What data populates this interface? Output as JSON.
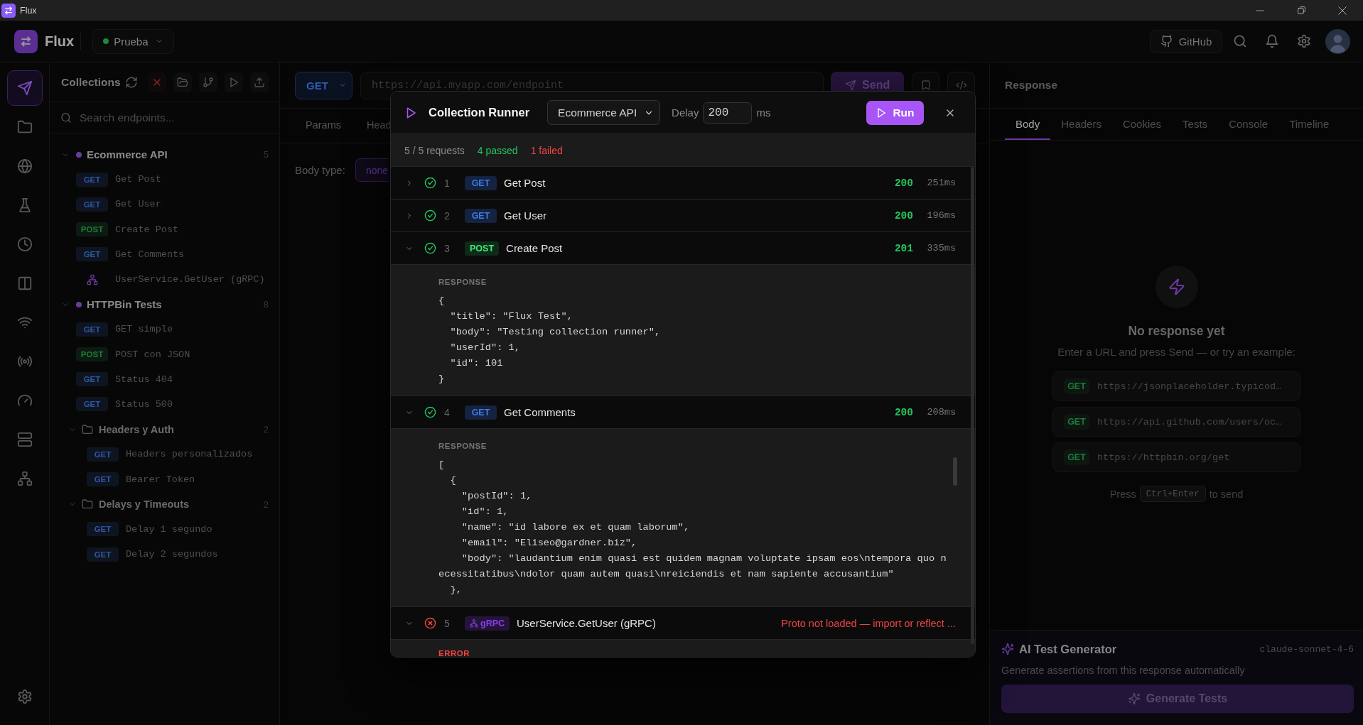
{
  "window": {
    "title": "Flux"
  },
  "header": {
    "app_name": "Flux",
    "environment": "Prueba",
    "github_button": "GitHub"
  },
  "rail": {
    "items": [
      {
        "selected": true
      },
      {
        "selected": false
      },
      {
        "selected": false
      },
      {
        "selected": false
      },
      {
        "selected": false
      },
      {
        "selected": false
      },
      {
        "selected": false
      },
      {
        "selected": false
      },
      {
        "selected": false
      },
      {
        "selected": false
      },
      {
        "selected": false
      }
    ]
  },
  "collections": {
    "title": "Collections",
    "search": {
      "placeholder": "Search endpoints..."
    },
    "tree": [
      {
        "kind": "collection",
        "name": "Ecommerce API",
        "count": "5",
        "expanded": true,
        "children": [
          {
            "kind": "request",
            "method": "GET",
            "color": "#2e56a8",
            "name": "Get Post"
          },
          {
            "kind": "request",
            "method": "GET",
            "color": "#2e56a8",
            "name": "Get User"
          },
          {
            "kind": "request",
            "method": "POST",
            "color": "#1f7f3a",
            "name": "Create Post"
          },
          {
            "kind": "request",
            "method": "GET",
            "color": "#2e56a8",
            "name": "Get Comments"
          },
          {
            "kind": "grpc",
            "name": "UserService.GetUser (gRPC)"
          }
        ]
      },
      {
        "kind": "collection",
        "name": "HTTPBin Tests",
        "count": "8",
        "expanded": true,
        "children": [
          {
            "kind": "request",
            "method": "GET",
            "color": "#2e56a8",
            "name": "GET simple"
          },
          {
            "kind": "request",
            "method": "POST",
            "color": "#1f7f3a",
            "name": "POST con JSON"
          },
          {
            "kind": "request",
            "method": "GET",
            "color": "#2e56a8",
            "name": "Status 404"
          },
          {
            "kind": "request",
            "method": "GET",
            "color": "#2e56a8",
            "name": "Status 500"
          },
          {
            "kind": "folder",
            "name": "Headers y Auth",
            "count": "2",
            "expanded": true,
            "children": [
              {
                "kind": "request",
                "method": "GET",
                "color": "#2e56a8",
                "name": "Headers personalizados"
              },
              {
                "kind": "request",
                "method": "GET",
                "color": "#2e56a8",
                "name": "Bearer Token"
              }
            ]
          },
          {
            "kind": "folder",
            "name": "Delays y Timeouts",
            "count": "2",
            "expanded": true,
            "children": [
              {
                "kind": "request",
                "method": "GET",
                "color": "#2e56a8",
                "name": "Delay 1 segundo"
              },
              {
                "kind": "request",
                "method": "GET",
                "color": "#2e56a8",
                "name": "Delay 2 segundos"
              }
            ]
          }
        ]
      }
    ]
  },
  "request": {
    "method": "GET",
    "url_field": {
      "placeholder": "https://api.myapp.com/endpoint"
    },
    "send_button": "Send",
    "tabs": [
      {
        "label": "Params",
        "selected": false
      },
      {
        "label": "Head",
        "selected": false
      }
    ],
    "body_type_label": "Body type:",
    "body_type": "none"
  },
  "response_panel": {
    "title": "Response",
    "tabs": [
      {
        "label": "Body",
        "selected": true
      },
      {
        "label": "Headers",
        "selected": false
      },
      {
        "label": "Cookies",
        "selected": false
      },
      {
        "label": "Tests",
        "selected": false
      },
      {
        "label": "Console",
        "selected": false
      },
      {
        "label": "Timeline",
        "selected": false
      }
    ],
    "empty_state": {
      "title": "No response yet",
      "subtitle": "Enter a URL and press Send — or try an example:",
      "examples": [
        {
          "method": "GET",
          "color": "#1e7a3c",
          "url": "https://jsonplaceholder.typicod…"
        },
        {
          "method": "GET",
          "color": "#1e7a3c",
          "url": "https://api.github.com/users/oc…"
        },
        {
          "method": "GET",
          "color": "#1e7a3c",
          "url": "https://httpbin.org/get"
        }
      ],
      "hint": {
        "before": "Press",
        "key": "Ctrl+Enter",
        "after": "to send"
      }
    },
    "ai_generator": {
      "title": "AI Test Generator",
      "model": "claude-sonnet-4-6",
      "description": "Generate assertions from this response automatically",
      "button": "Generate Tests"
    }
  },
  "runner": {
    "title": "Collection Runner",
    "collection": "Ecommerce API",
    "delay_label": "Delay",
    "delay": "200",
    "delay_unit": "ms",
    "run_button": "Run",
    "summary": {
      "requests": "5 / 5 requests",
      "passed": "4 passed",
      "failed": "1 failed"
    },
    "results": [
      {
        "index": "1",
        "kind": "http",
        "passed": true,
        "method": "GET",
        "color": "#14233f",
        "name": "Get Post",
        "code": "200",
        "time": "251ms",
        "expanded": false
      },
      {
        "index": "2",
        "kind": "http",
        "passed": true,
        "method": "GET",
        "color": "#14233f",
        "name": "Get User",
        "code": "200",
        "time": "196ms",
        "expanded": false
      },
      {
        "index": "3",
        "kind": "http",
        "passed": true,
        "method": "POST",
        "color": "#0f2a18",
        "name": "Create Post",
        "code": "201",
        "time": "335ms",
        "expanded": true,
        "detail": {
          "kind": "response",
          "label": "RESPONSE",
          "lines": [
            "{",
            "  \"title\": \"Flux Test\",",
            "  \"body\": \"Testing collection runner\",",
            "  \"userId\": 1,",
            "  \"id\": 101",
            "}"
          ]
        }
      },
      {
        "index": "4",
        "kind": "http",
        "passed": true,
        "method": "GET",
        "color": "#14233f",
        "name": "Get Comments",
        "code": "200",
        "time": "208ms",
        "expanded": true,
        "detail": {
          "kind": "response",
          "label": "RESPONSE",
          "lines": [
            "[",
            "  {",
            "    \"postId\": 1,",
            "    \"id\": 1,",
            "    \"name\": \"id labore ex et quam laborum\",",
            "    \"email\": \"Eliseo@gardner.biz\",",
            "    \"body\": \"laudantium enim quasi est quidem magnam voluptate ipsam eos\\ntempora quo necessitatibus\\ndolor quam autem quasi\\nreiciendis et nam sapiente accusantium\"",
            "  },"
          ]
        }
      },
      {
        "index": "5",
        "kind": "grpc",
        "passed": false,
        "method": "gRPC",
        "color": "#25143a",
        "name": "UserService.GetUser (gRPC)",
        "error": "Proto not loaded — import or reflect ...",
        "expanded": true,
        "detail": {
          "kind": "error",
          "label": "ERROR"
        }
      }
    ]
  }
}
